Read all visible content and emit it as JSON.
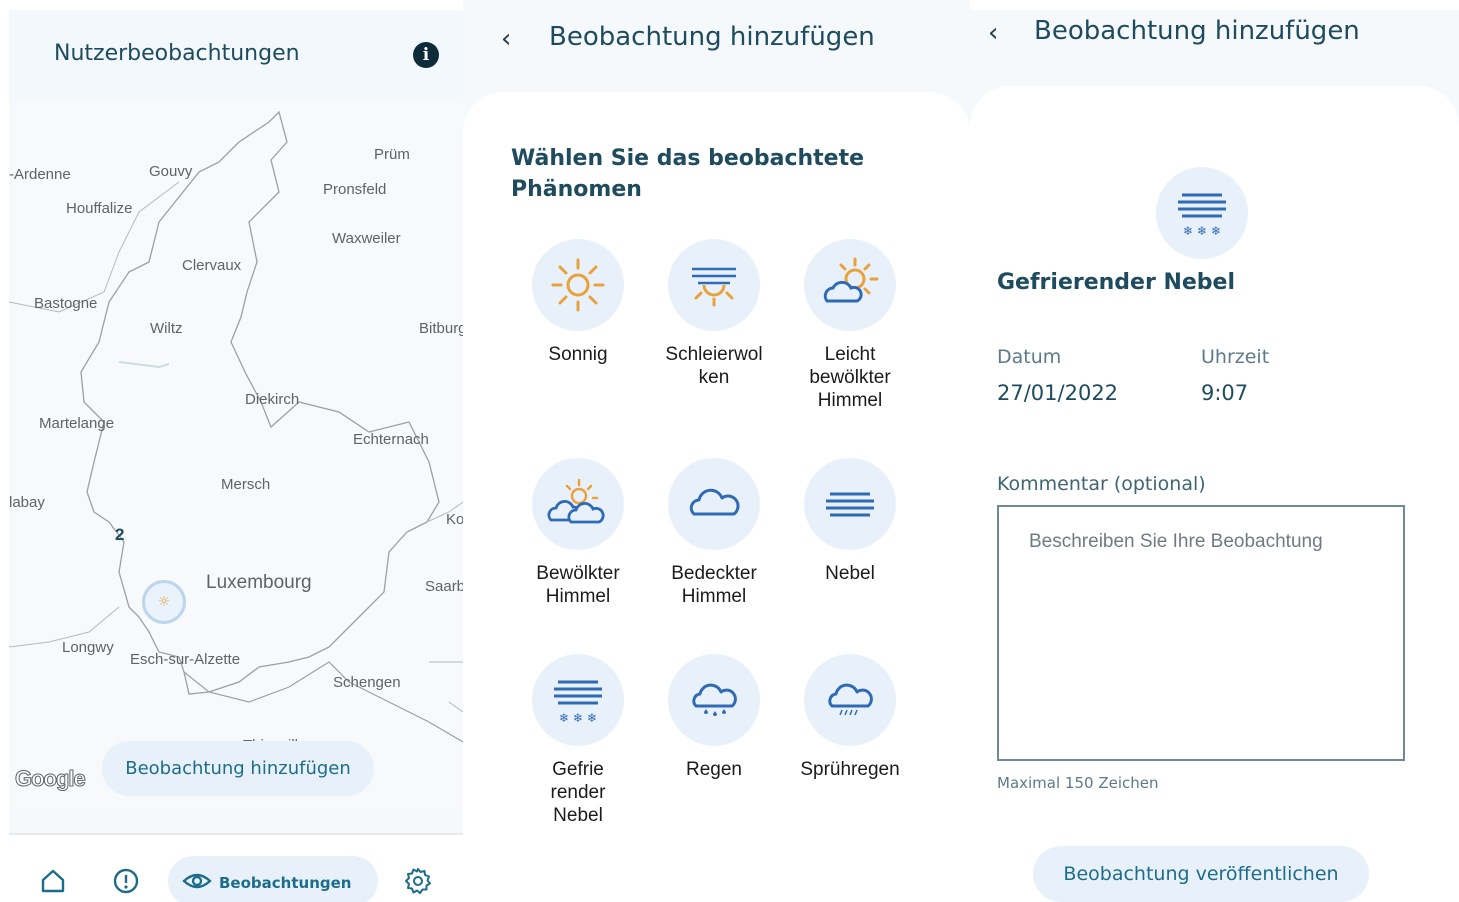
{
  "panel1": {
    "title": "Nutzerbeobachtungen",
    "info_icon": "info-icon",
    "map": {
      "places": [
        "-Ardenne",
        "Gouvy",
        "Prüm",
        "Pronsfeld",
        "Houffalize",
        "Waxweiler",
        "Clervaux",
        "Bastogne",
        "Wiltz",
        "Bitburg",
        "Diekirch",
        "Martelange",
        "Echternach",
        "Mersch",
        "labay",
        "Ko",
        "Luxembourg",
        "Saarb",
        "Longwy",
        "Esch-sur-Alzette",
        "Schengen",
        "Thionville"
      ],
      "cluster_count": "2",
      "marker_icon": "sun-icon",
      "google_logo": "Google"
    },
    "add_button": "Beobachtung hinzufügen",
    "nav": {
      "home_icon": "home-icon",
      "warnings_icon": "alert-icon",
      "observations_label": "Beobachtungen",
      "observations_icon": "eye-icon",
      "settings_icon": "gear-icon"
    }
  },
  "panel2": {
    "back_icon": "‹",
    "title": "Beobachtung hinzufügen",
    "heading": "Wählen Sie das beobachtete Phänomen",
    "phenomena": [
      {
        "label": "Sonnig",
        "icon": "sun-icon"
      },
      {
        "label": "Schleierwolken",
        "icon": "veiled-sun-icon"
      },
      {
        "label": "Leicht bewölkter Himmel",
        "icon": "partly-cloudy-icon"
      },
      {
        "label": "Bewölkter Himmel",
        "icon": "cloudy-icon"
      },
      {
        "label": "Bedeckter Himmel",
        "icon": "overcast-icon"
      },
      {
        "label": "Nebel",
        "icon": "fog-icon"
      },
      {
        "label": "Gefrierender Nebel",
        "icon": "freezing-fog-icon"
      },
      {
        "label": "Regen",
        "icon": "rain-icon"
      },
      {
        "label": "Sprühregen",
        "icon": "drizzle-icon"
      }
    ],
    "phenomena_display": [
      "Sonnig",
      "Schleierwol\nken",
      "Leicht\nbewölkter\nHimmel",
      "Bewölkter\nHimmel",
      "Bedeckter\nHimmel",
      "Nebel",
      "Gefrie\nrender\nNebel",
      "Regen",
      "Sprühregen"
    ]
  },
  "panel3": {
    "back_icon": "‹",
    "title": "Beobachtung hinzufügen",
    "phenomenon": "Gefrierender Nebel",
    "phenomenon_icon": "freezing-fog-icon",
    "date_label": "Datum",
    "date_value": "27/01/2022",
    "time_label": "Uhrzeit",
    "time_value": "9:07",
    "comment_label": "Kommentar (optional)",
    "comment_placeholder": "Beschreiben Sie Ihre Beobachtung",
    "max_chars": "Maximal 150 Zeichen",
    "publish_button": "Beobachtung veröffentlichen"
  },
  "colors": {
    "accent": "#1d6d8a",
    "title": "#1e4b5e",
    "chip_bg": "#e8f1fa",
    "icon_blue": "#2f6bb5",
    "icon_sun": "#e9a23b"
  }
}
